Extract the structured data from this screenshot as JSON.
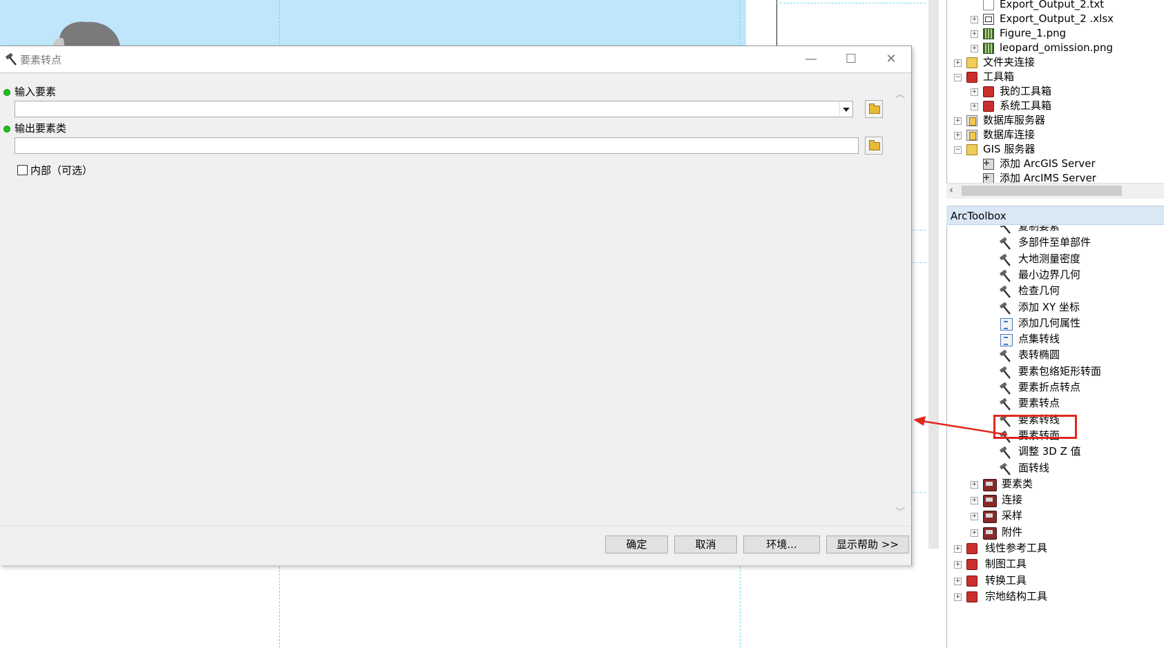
{
  "dialog": {
    "title": "要素转点",
    "input_features_label": "输入要素",
    "input_features_value": "",
    "output_class_label": "输出要素类",
    "output_class_value": "",
    "inside_label": "内部（可选）",
    "inside_checked": false,
    "buttons": {
      "ok": "确定",
      "cancel": "取消",
      "environments": "环境...",
      "show_help": "显示帮助 >>"
    }
  },
  "catalog": {
    "items": [
      {
        "label": "Export_Output_2.txt",
        "icon": "text-file-icon",
        "expander": ""
      },
      {
        "label": "Export_Output_2 .xlsx",
        "icon": "xlsx-icon",
        "expander": "+"
      },
      {
        "label": "Figure_1.png",
        "icon": "raster-icon",
        "expander": "+"
      },
      {
        "label": "leopard_omission.png",
        "icon": "raster-icon",
        "expander": "+"
      },
      {
        "label": "文件夹连接",
        "icon": "folder-icon",
        "expander": "+"
      },
      {
        "label": "工具箱",
        "icon": "toolbox-icon",
        "expander": "−"
      },
      {
        "label": "我的工具箱",
        "icon": "toolbox-icon",
        "expander": "+"
      },
      {
        "label": "系统工具箱",
        "icon": "toolbox-icon",
        "expander": "+"
      },
      {
        "label": "数据库服务器",
        "icon": "database-server-icon",
        "expander": "+"
      },
      {
        "label": "数据库连接",
        "icon": "database-connection-icon",
        "expander": "+"
      },
      {
        "label": "GIS 服务器",
        "icon": "gis-server-icon",
        "expander": "−"
      },
      {
        "label": "添加 ArcGIS Server",
        "icon": "add-server-icon",
        "expander": ""
      },
      {
        "label": "添加 ArcIMS Server",
        "icon": "add-server-icon",
        "expander": ""
      }
    ]
  },
  "arctoolbox": {
    "title": "ArcToolbox",
    "tools": [
      {
        "label": "复制要素",
        "icon": "hammer-icon"
      },
      {
        "label": "多部件至单部件",
        "icon": "hammer-icon"
      },
      {
        "label": "大地测量密度",
        "icon": "hammer-icon"
      },
      {
        "label": "最小边界几何",
        "icon": "hammer-icon"
      },
      {
        "label": "检查几何",
        "icon": "hammer-icon"
      },
      {
        "label": "添加 XY 坐标",
        "icon": "hammer-icon"
      },
      {
        "label": "添加几何属性",
        "icon": "script-icon"
      },
      {
        "label": "点集转线",
        "icon": "script-icon"
      },
      {
        "label": "表转椭圆",
        "icon": "hammer-icon"
      },
      {
        "label": "要素包络矩形转面",
        "icon": "hammer-icon"
      },
      {
        "label": "要素折点转点",
        "icon": "hammer-icon"
      },
      {
        "label": "要素转点",
        "icon": "hammer-icon"
      },
      {
        "label": "要素转线",
        "icon": "hammer-icon"
      },
      {
        "label": "要素转面",
        "icon": "hammer-icon"
      },
      {
        "label": "调整 3D Z 值",
        "icon": "hammer-icon"
      },
      {
        "label": "面转线",
        "icon": "hammer-icon"
      }
    ],
    "toolsets": [
      {
        "label": "要素类",
        "icon": "toolset-icon"
      },
      {
        "label": "连接",
        "icon": "toolset-icon"
      },
      {
        "label": "采样",
        "icon": "toolset-icon"
      },
      {
        "label": "附件",
        "icon": "toolset-icon"
      }
    ],
    "toolboxes": [
      {
        "label": "线性参考工具",
        "icon": "toolbox-icon"
      },
      {
        "label": "制图工具",
        "icon": "toolbox-icon"
      },
      {
        "label": "转换工具",
        "icon": "toolbox-icon"
      },
      {
        "label": "宗地结构工具",
        "icon": "toolbox-icon"
      }
    ]
  },
  "colors": {
    "highlight": "#e0281f",
    "required_dot": "#1ec01e",
    "map_blue": "#bfe6fb"
  }
}
